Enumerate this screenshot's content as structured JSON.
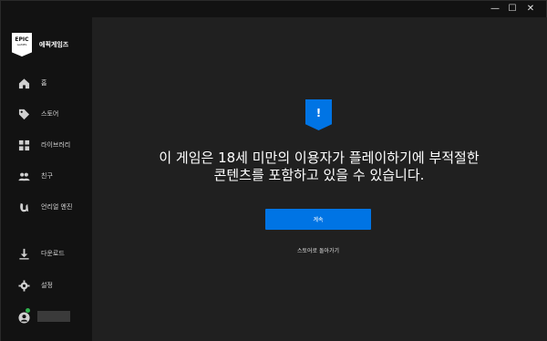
{
  "window": {
    "controls": {
      "minimize": "—",
      "maximize": "☐",
      "close": "✕"
    }
  },
  "sidebar": {
    "brand": "에픽게임즈",
    "logo_text": "EPIC",
    "logo_sub": "GAMES",
    "items": [
      {
        "label": "홈",
        "icon": "home-icon"
      },
      {
        "label": "스토어",
        "icon": "tag-icon"
      },
      {
        "label": "라이브러리",
        "icon": "grid-icon"
      },
      {
        "label": "친구",
        "icon": "friends-icon"
      },
      {
        "label": "언리얼 엔진",
        "icon": "unreal-icon"
      },
      {
        "label": "다운로드",
        "icon": "download-icon"
      },
      {
        "label": "설정",
        "icon": "gear-icon"
      }
    ],
    "user": {
      "status_color": "#30b34e",
      "name_obscured": true
    }
  },
  "main": {
    "badge_icon": "!",
    "warning_text": "이 게임은 18세 미만의 이용자가 플레이하기에 부적절한 콘텐츠를 포함하고 있을 수 있습니다.",
    "continue_label": "계속",
    "back_label": "스토어로 돌아가기"
  },
  "colors": {
    "accent": "#0074e4",
    "sidebar_bg": "#121212",
    "main_bg": "#202020"
  }
}
